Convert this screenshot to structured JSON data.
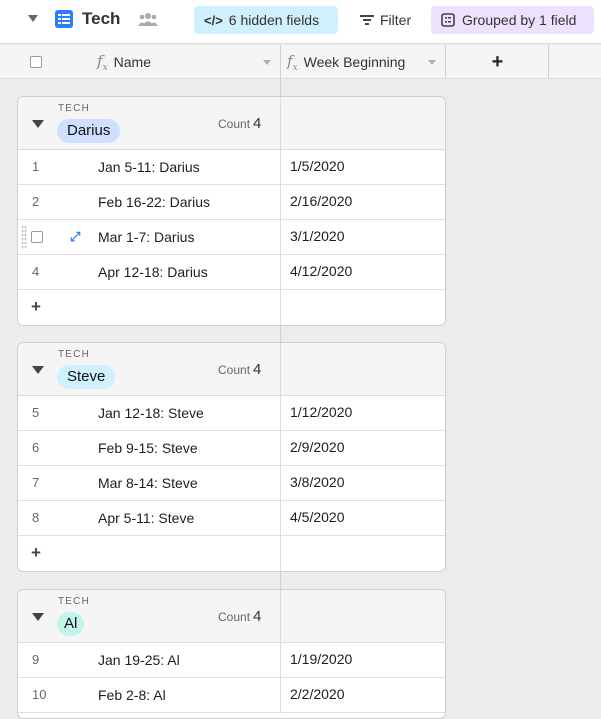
{
  "toolbar": {
    "view_name": "Tech",
    "hidden_fields_label": "6 hidden fields",
    "filter_label": "Filter",
    "grouped_label": "Grouped by 1 field",
    "colors": {
      "hidden_bg": "#d0f0fd",
      "grouped_bg": "#ede2fe",
      "accent": "#2d7ff9"
    }
  },
  "columns": [
    {
      "label": "Name",
      "type_icon": "formula-icon"
    },
    {
      "label": "Week Beginning",
      "type_icon": "formula-icon"
    }
  ],
  "add_column_label": "+",
  "groups": [
    {
      "field_label": "TECH",
      "value": "Darius",
      "chip_color": "#cfdfff",
      "count_label": "Count",
      "count": "4",
      "rows": [
        {
          "num": "1",
          "name": "Jan 5-11: Darius",
          "date": "1/5/2020"
        },
        {
          "num": "2",
          "name": "Feb 16-22: Darius",
          "date": "2/16/2020"
        },
        {
          "num": "3",
          "name": "Mar 1-7: Darius",
          "date": "3/1/2020",
          "hovered": true
        },
        {
          "num": "4",
          "name": "Apr 12-18: Darius",
          "date": "4/12/2020"
        }
      ]
    },
    {
      "field_label": "TECH",
      "value": "Steve",
      "chip_color": "#d0f0fd",
      "count_label": "Count",
      "count": "4",
      "rows": [
        {
          "num": "5",
          "name": "Jan 12-18: Steve",
          "date": "1/12/2020"
        },
        {
          "num": "6",
          "name": "Feb 9-15: Steve",
          "date": "2/9/2020"
        },
        {
          "num": "7",
          "name": "Mar 8-14: Steve",
          "date": "3/8/2020"
        },
        {
          "num": "8",
          "name": "Apr 5-11: Steve",
          "date": "4/5/2020"
        }
      ]
    },
    {
      "field_label": "TECH",
      "value": "Al",
      "chip_color": "#c2f5e9",
      "count_label": "Count",
      "count": "4",
      "rows": [
        {
          "num": "9",
          "name": "Jan 19-25: Al",
          "date": "1/19/2020"
        },
        {
          "num": "10",
          "name": "Feb 2-8: Al",
          "date": "2/2/2020"
        }
      ]
    }
  ],
  "add_row_label": "+"
}
